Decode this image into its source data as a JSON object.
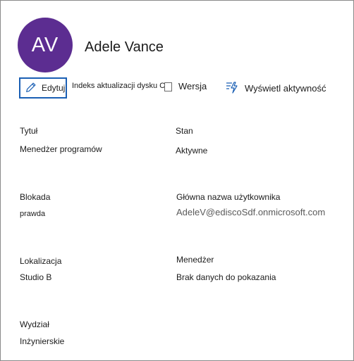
{
  "profile": {
    "initials": "AV",
    "name": "Adele Vance",
    "avatar_color": "#5c2d91"
  },
  "toolbar": {
    "edit_label": "Edytuj",
    "holds_label": "Indeks aktualizacji dysku CD",
    "version_label": "Wersja",
    "activity_label": "Wyświetl aktywność",
    "accent_color": "#1a5fb4"
  },
  "fields": {
    "title": {
      "label": "Tytuł",
      "value": "Menedżer programów"
    },
    "status": {
      "label": "Stan",
      "value": "Aktywne"
    },
    "hold": {
      "label": "Blokada",
      "value": "prawda"
    },
    "upn": {
      "label": "Główna nazwa użytkownika",
      "value": "AdeleV@ediscoSdf.onmicrosoft.com"
    },
    "location": {
      "label": "Lokalizacja",
      "value": "Studio B"
    },
    "manager": {
      "label": "Menedżer",
      "value": "Brak danych do pokazania"
    },
    "department": {
      "label": "Wydział",
      "value": "Inżynierskie"
    }
  }
}
